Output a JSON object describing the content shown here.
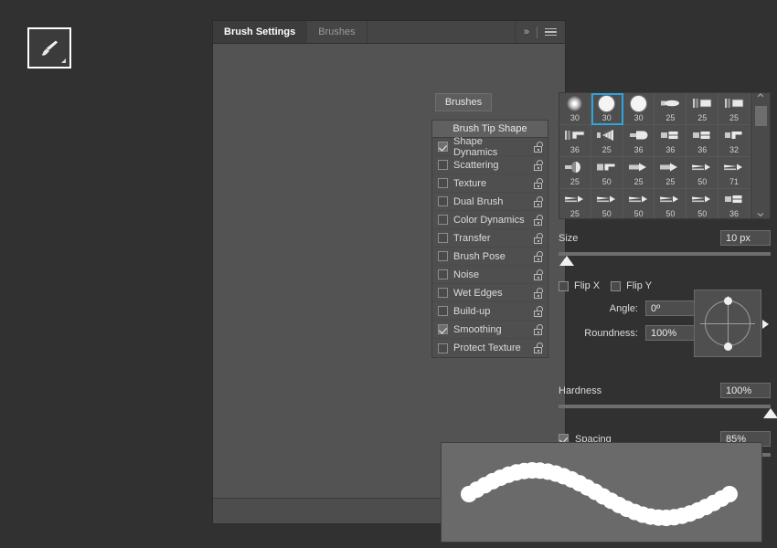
{
  "app": {
    "background_color": "#313131",
    "panel_color": "#535353",
    "accent_color": "#2ea5e0"
  },
  "toolbar": {
    "tool_icon": "brush-tool-icon",
    "tool_name": "Brush Tool"
  },
  "panel": {
    "tabs": [
      {
        "label": "Brush Settings",
        "active": true
      },
      {
        "label": "Brushes",
        "active": false
      }
    ],
    "header_icons": [
      {
        "name": "collapse-chevrons-icon",
        "glyph": "»"
      },
      {
        "name": "panel-menu-icon",
        "glyph": "menu"
      }
    ],
    "brushes_button": {
      "label": "Brushes"
    }
  },
  "options": {
    "header": "Brush Tip Shape",
    "items": [
      {
        "label": "Shape Dynamics",
        "checked": true,
        "locked": false
      },
      {
        "label": "Scattering",
        "checked": false,
        "locked": false
      },
      {
        "label": "Texture",
        "checked": false,
        "locked": false
      },
      {
        "label": "Dual Brush",
        "checked": false,
        "locked": false
      },
      {
        "label": "Color Dynamics",
        "checked": false,
        "locked": false
      },
      {
        "label": "Transfer",
        "checked": false,
        "locked": false
      },
      {
        "label": "Brush Pose",
        "checked": false,
        "locked": false
      },
      {
        "label": "Noise",
        "checked": false,
        "locked": false
      },
      {
        "label": "Wet Edges",
        "checked": false,
        "locked": false
      },
      {
        "label": "Build-up",
        "checked": false,
        "locked": false
      },
      {
        "label": "Smoothing",
        "checked": true,
        "locked": false
      },
      {
        "label": "Protect Texture",
        "checked": false,
        "locked": false
      }
    ]
  },
  "brush_grid": {
    "selected_index": 1,
    "scroll_up_glyph": "⌃",
    "scroll_down_glyph": "⌄",
    "presets": [
      {
        "size": "30",
        "shape": "soft-round"
      },
      {
        "size": "30",
        "shape": "hard-round"
      },
      {
        "size": "30",
        "shape": "hard-round"
      },
      {
        "size": "25",
        "shape": "flat-tip"
      },
      {
        "size": "25",
        "shape": "bristle-flat"
      },
      {
        "size": "25",
        "shape": "bristle-flat"
      },
      {
        "size": "36",
        "shape": "bristle-angle"
      },
      {
        "size": "25",
        "shape": "bristle-fan"
      },
      {
        "size": "36",
        "shape": "round-point"
      },
      {
        "size": "36",
        "shape": "flat-block"
      },
      {
        "size": "36",
        "shape": "flat-block"
      },
      {
        "size": "32",
        "shape": "angle-block"
      },
      {
        "size": "25",
        "shape": "round-blunt"
      },
      {
        "size": "50",
        "shape": "flat-angle"
      },
      {
        "size": "25",
        "shape": "flat-arrow"
      },
      {
        "size": "25",
        "shape": "flat-arrow"
      },
      {
        "size": "50",
        "shape": "pencil-thin"
      },
      {
        "size": "71",
        "shape": "pencil-thin"
      },
      {
        "size": "25",
        "shape": "pencil-thin"
      },
      {
        "size": "50",
        "shape": "pencil-thin"
      },
      {
        "size": "50",
        "shape": "pencil-thin"
      },
      {
        "size": "50",
        "shape": "pencil-thin"
      },
      {
        "size": "50",
        "shape": "pencil-thin"
      },
      {
        "size": "36",
        "shape": "flat-block"
      }
    ]
  },
  "controls": {
    "size": {
      "label": "Size",
      "value": "10 px",
      "slider_percent": 4
    },
    "flip_x": {
      "label": "Flip X",
      "checked": false
    },
    "flip_y": {
      "label": "Flip Y",
      "checked": false
    },
    "angle": {
      "label": "Angle:",
      "value": "0º"
    },
    "roundness": {
      "label": "Roundness:",
      "value": "100%"
    },
    "hardness": {
      "label": "Hardness",
      "value": "100%",
      "slider_percent": 100
    },
    "spacing": {
      "label": "Spacing",
      "value": "85%",
      "checked": true,
      "slider_percent": 41
    }
  },
  "preview": {
    "name": "brush-stroke-preview",
    "stroke_color": "#ffffff",
    "background_color": "#6a6a6a"
  },
  "footer": {
    "icons": [
      {
        "name": "live-tip-brush-icon"
      },
      {
        "name": "new-brush-icon"
      }
    ]
  }
}
